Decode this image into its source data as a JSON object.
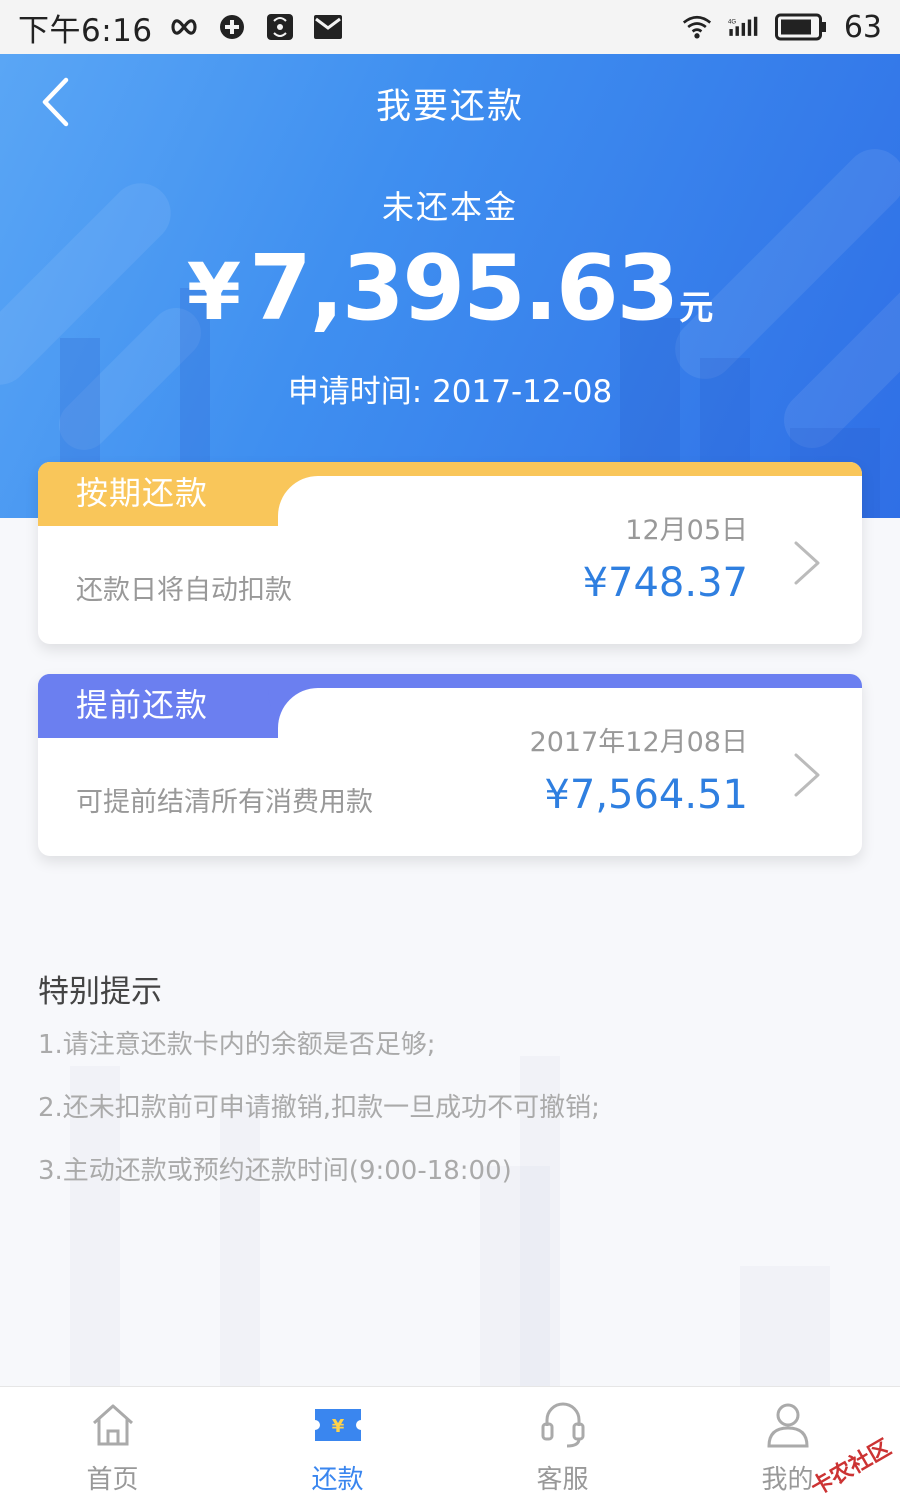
{
  "status_bar": {
    "time": "下午6:16",
    "battery": "63",
    "left_icons": [
      "infinity-icon",
      "vpn-icon",
      "wireless-icon",
      "mail-icon"
    ],
    "right_icons": [
      "wifi-icon",
      "signal-4g-icon",
      "battery-icon"
    ]
  },
  "header": {
    "title": "我要还款",
    "principal_label": "未还本金",
    "principal_currency": "¥",
    "principal_value": "7,395.63",
    "principal_unit": "元",
    "apply_date": "申请时间: 2017-12-08"
  },
  "cards": [
    {
      "tag": "按期还款",
      "description": "还款日将自动扣款",
      "date": "12月05日",
      "amount": "¥748.37",
      "accent": "#f9c65a"
    },
    {
      "tag": "提前还款",
      "description": "可提前结清所有消费用款",
      "date": "2017年12月08日",
      "amount": "¥7,564.51",
      "accent": "#6b7ff0"
    }
  ],
  "tips": {
    "title": "特别提示",
    "items": [
      "1.请注意还款卡内的余额是否足够;",
      "2.还未扣款前可申请撤销,扣款一旦成功不可撤销;",
      "3.主动还款或预约还款时间(9:00-18:00)"
    ]
  },
  "tabbar": {
    "items": [
      {
        "label": "首页",
        "icon": "home-icon",
        "active": false
      },
      {
        "label": "还款",
        "icon": "repay-ticket-icon",
        "active": true
      },
      {
        "label": "客服",
        "icon": "headset-icon",
        "active": false
      },
      {
        "label": "我的",
        "icon": "user-icon",
        "active": false
      }
    ]
  },
  "colors": {
    "brand_blue": "#3a86ef",
    "amount_blue": "#2f7fe0",
    "banner_start": "#5aa6f5",
    "banner_end": "#2f6fe6"
  },
  "watermark": "卡农社区"
}
